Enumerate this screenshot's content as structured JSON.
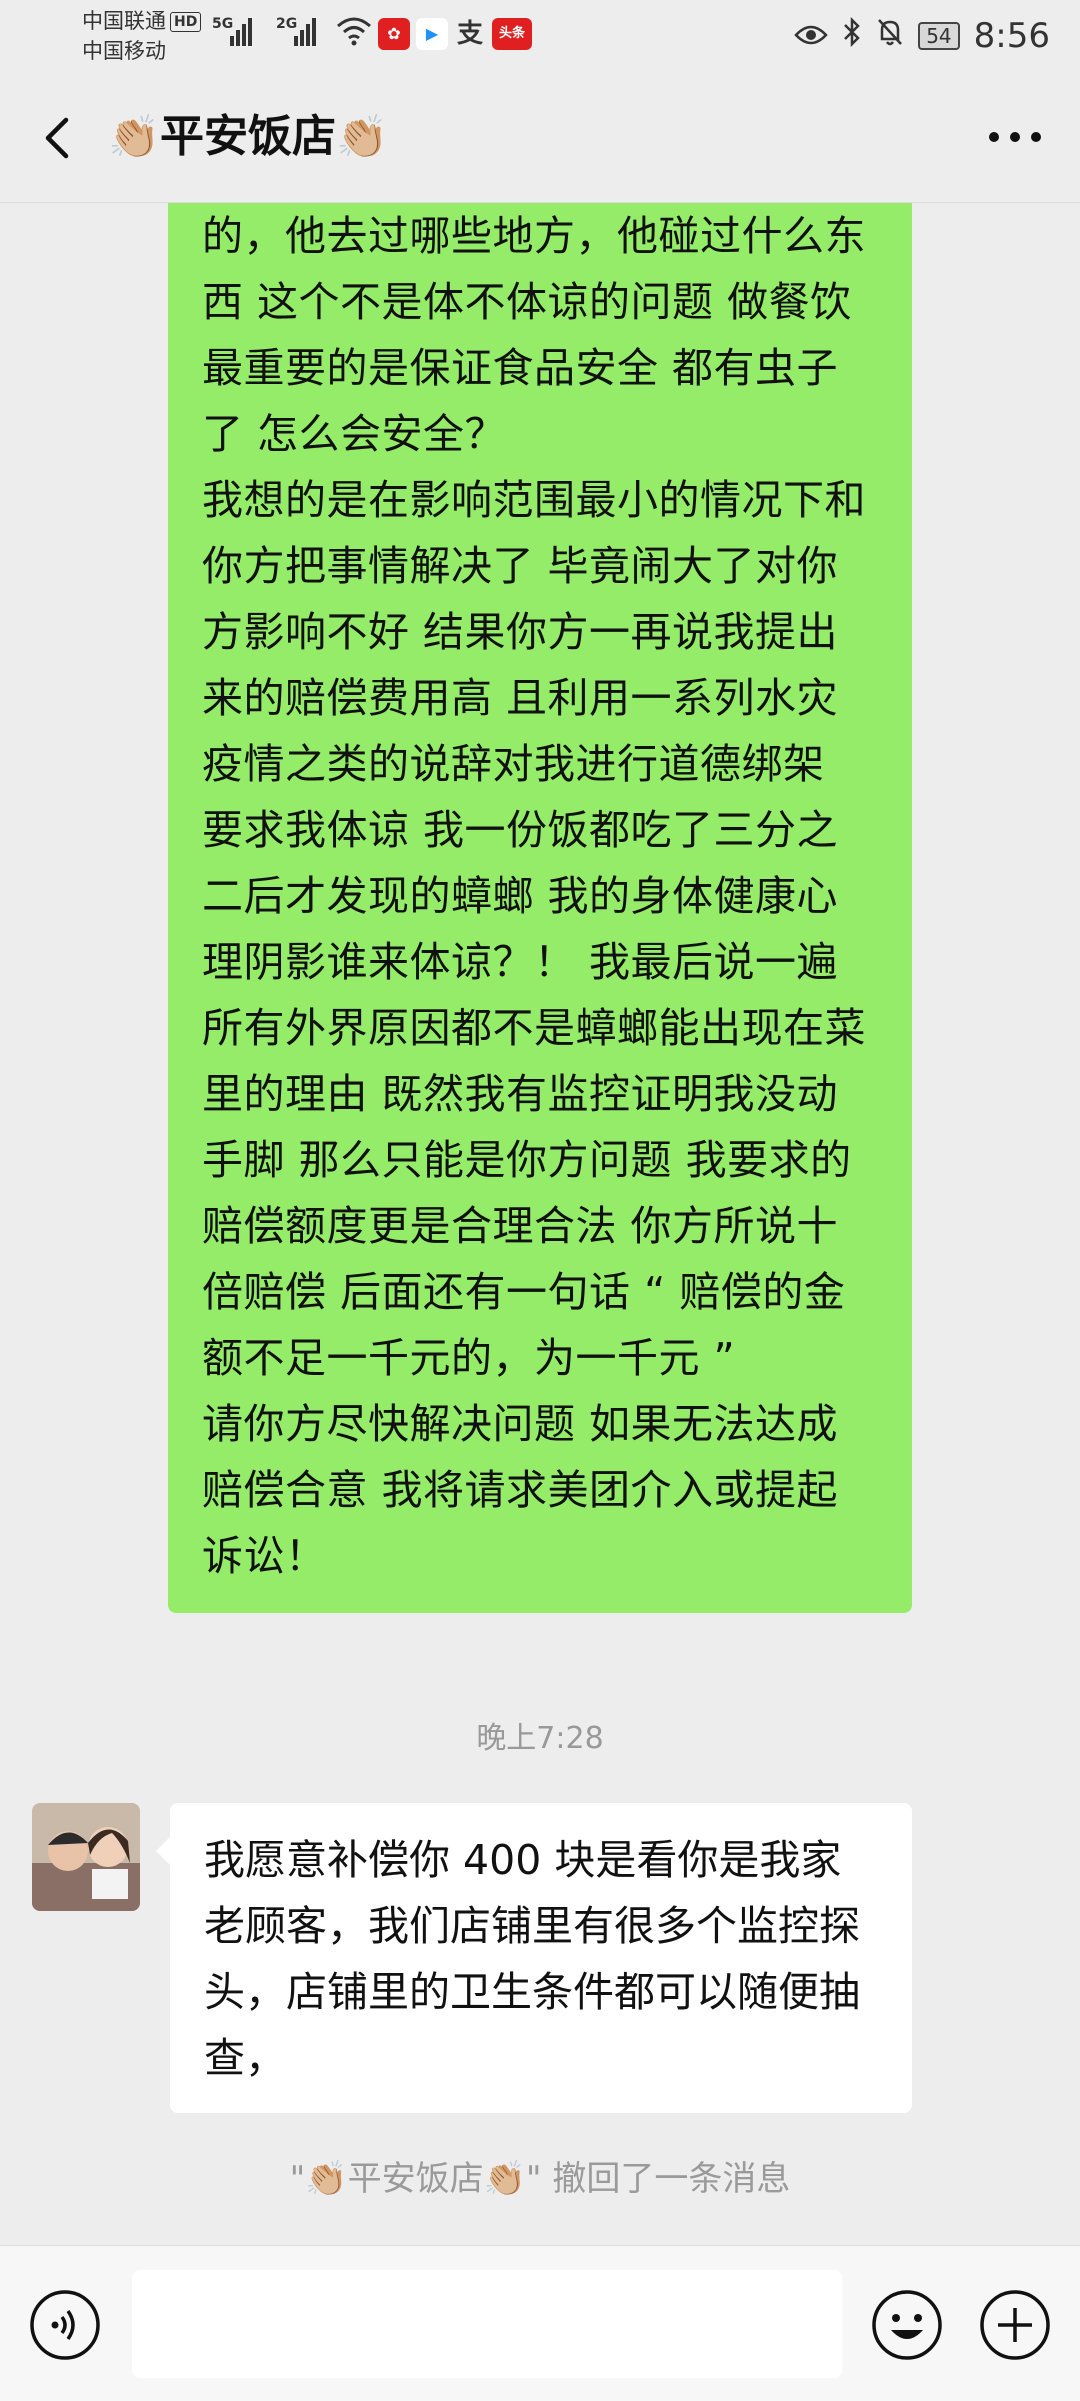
{
  "status_bar": {
    "carrier_1": "中国联通",
    "hd_badge": "HD",
    "carrier_2": "中国移动",
    "net_1": "5G",
    "net_2": "2G",
    "app_badge_toutiao": "头条",
    "battery": "54",
    "time": "8:56"
  },
  "header": {
    "title_emoji_left": "👏🏼",
    "title": "平安饭店",
    "title_emoji_right": "👏🏼"
  },
  "messages": {
    "sent_text": "的，他去过哪些地方，他碰过什么东西 这个不是体不体谅的问题 做餐饮最重要的是保证食品安全 都有虫子了 怎么会安全？\n我想的是在影响范围最小的情况下和你方把事情解决了 毕竟闹大了对你方影响不好 结果你方一再说我提出来的赔偿费用高 且利用一系列水灾疫情之类的说辞对我进行道德绑架 要求我体谅 我一份饭都吃了三分之二后才发现的蟑螂 我的身体健康心理阴影谁来体谅？！ 我最后说一遍 所有外界原因都不是蟑螂能出现在菜里的理由 既然我有监控证明我没动手脚 那么只能是你方问题 我要求的赔偿额度更是合理合法 你方所说十倍赔偿 后面还有一句话 “ 赔偿的金额不足一千元的，为一千元 ”\n请你方尽快解决问题 如果无法达成赔偿合意 我将请求美团介入或提起诉讼！",
    "timestamp": "晚上7:28",
    "received_text": "我愿意补偿你 400 块是看你是我家老顾客，我们店铺里有很多个监控探头，店铺里的卫生条件都可以随便抽查，",
    "recall_notice": "\"👏🏼平安饭店👏🏼\" 撤回了一条消息"
  },
  "input_bar": {
    "value": "",
    "placeholder": ""
  },
  "colors": {
    "sent_bubble": "#95ec69",
    "received_bubble": "#ffffff",
    "background": "#ededed"
  }
}
